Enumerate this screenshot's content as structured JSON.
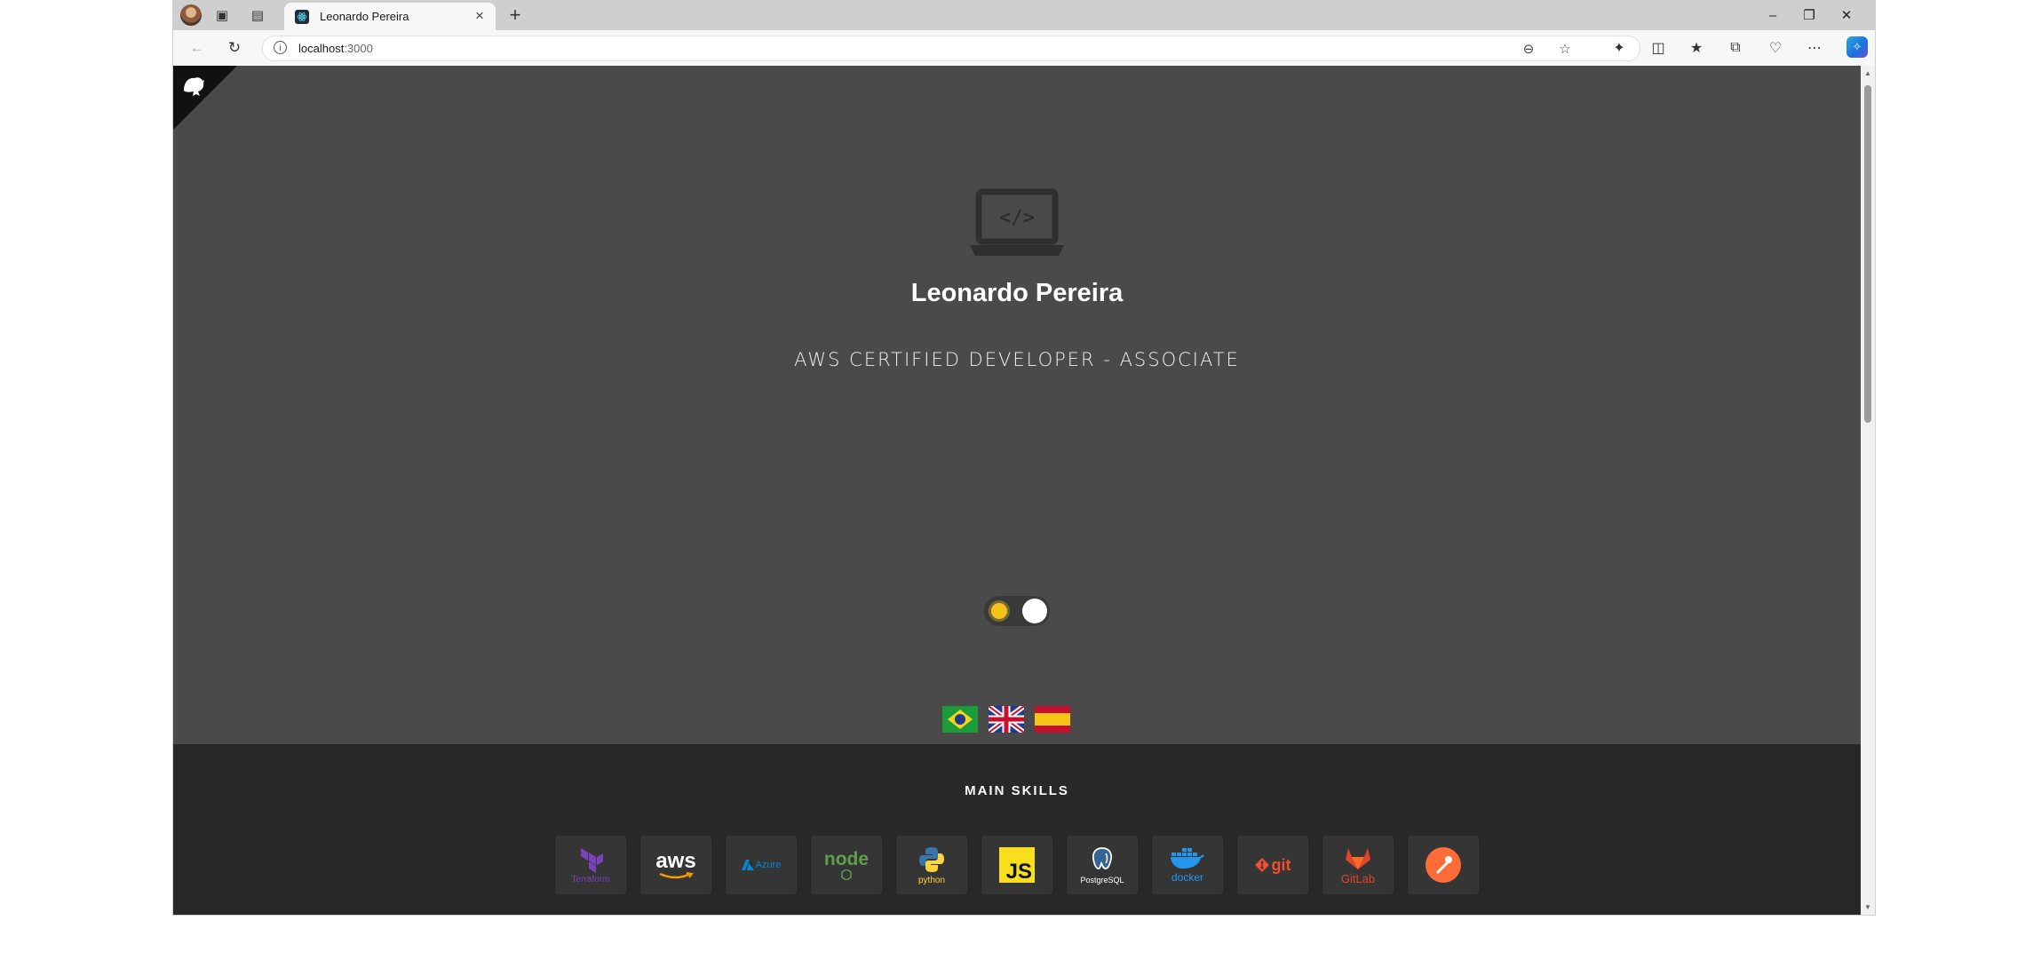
{
  "browser": {
    "tab_title": "Leonardo Pereira",
    "tab_close": "×",
    "new_tab": "+",
    "url_host": "localhost",
    "url_port": ":3000",
    "info_glyph": "i",
    "window_controls": [
      "–",
      "❐",
      "✕"
    ]
  },
  "page": {
    "name": "Leonardo Pereira",
    "subtitle": "AWS CERTIFIED DEVELOPER - ASSOCIATE",
    "theme_toggle": {
      "mode": "light",
      "icon": "sun-icon"
    },
    "languages": [
      "pt-BR",
      "en-GB",
      "es-ES"
    ],
    "skills_title": "MAIN SKILLS",
    "skills": [
      {
        "name": "Terraform",
        "label": "Terraform",
        "color": "#7b42bc"
      },
      {
        "name": "AWS",
        "label": "aws",
        "color": "#ff9900"
      },
      {
        "name": "Azure",
        "label": "Azure",
        "color": "#0089d6"
      },
      {
        "name": "Node.js",
        "label": "node",
        "color": "#5fa04e"
      },
      {
        "name": "Python",
        "label": "python",
        "color": "#ffd43b"
      },
      {
        "name": "JavaScript",
        "label": "JS",
        "color": "#f7df1e"
      },
      {
        "name": "PostgreSQL",
        "label": "PostgreSQL",
        "color": "#ffffff"
      },
      {
        "name": "Docker",
        "label": "docker",
        "color": "#2496ed"
      },
      {
        "name": "Git",
        "label": "git",
        "color": "#f05032"
      },
      {
        "name": "GitLab",
        "label": "GitLab",
        "color": "#e24329"
      },
      {
        "name": "Postman",
        "label": "",
        "color": "#ff6c37"
      }
    ]
  },
  "colors": {
    "hero_bg": "#4a4a4a",
    "skills_bg": "#282828",
    "tile_bg": "#353535"
  }
}
